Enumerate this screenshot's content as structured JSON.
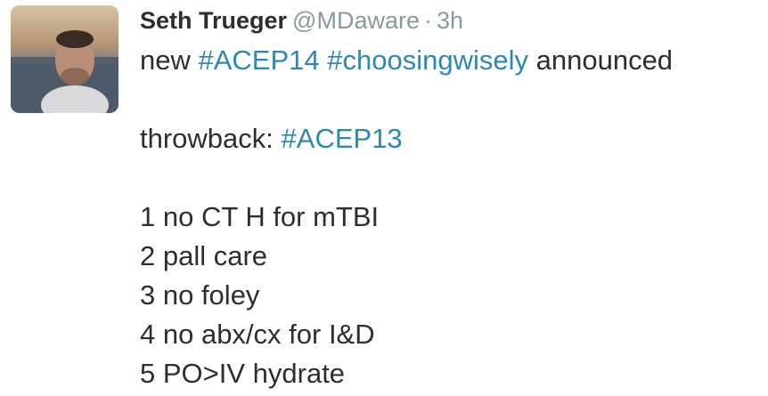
{
  "tweet": {
    "author_name": "Seth Trueger",
    "handle": "@MDaware",
    "separator": "·",
    "timestamp": "3h",
    "avatar_icon": "profile-photo",
    "lines": {
      "l1_word1": "new",
      "l1_tag1": "#ACEP14",
      "l1_tag2": "#choosingwisely",
      "l1_word2": "announced",
      "l2_word": "throwback:",
      "l2_tag": "#ACEP13",
      "items": [
        "1 no CT H for mTBI",
        "2 pall care",
        "3 no foley",
        "4 no abx/cx for I&D",
        "5 PO>IV hydrate"
      ]
    }
  },
  "colors": {
    "text": "#292f33",
    "muted": "#8899a6",
    "hashtag": "#2b8ab3"
  }
}
